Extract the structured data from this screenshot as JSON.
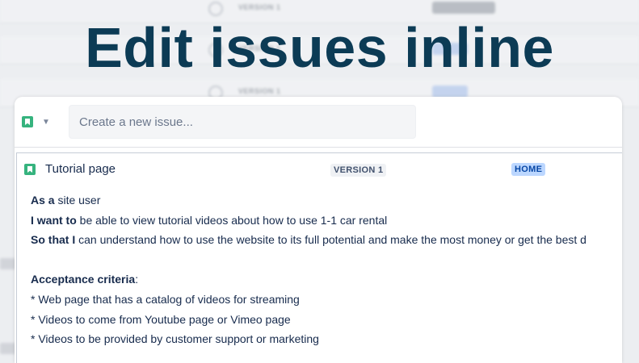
{
  "headline": "Edit issues inline",
  "background_rows": [
    {
      "version": "VERSION 1"
    },
    {
      "version": "VERSION 1"
    },
    {
      "version": "VERSION 1"
    }
  ],
  "create": {
    "placeholder": "Create a new issue...",
    "type_icon": "story-icon",
    "dropdown_icon": "chevron-down-icon"
  },
  "issue": {
    "type_icon": "story-icon",
    "title": "Tutorial page",
    "fix_version": "VERSION 1",
    "epic": "HOME",
    "description": {
      "as_a_label": "As a",
      "as_a_text": " site user",
      "i_want_label": "I want to",
      "i_want_text": " be able to view tutorial videos about how to use 1-1 car rental",
      "so_that_label": "So that I",
      "so_that_text": " can understand how to use the website to its full potential and make the most money or get the best d",
      "criteria_label": "Acceptance criteria",
      "criteria_colon": ":",
      "criteria": [
        "* Web page that has a catalog of videos for streaming",
        "* Videos to come from Youtube page or Vimeo page",
        "* Videos to be provided by customer support or marketing"
      ]
    }
  },
  "colors": {
    "headline": "#0c3b55",
    "story": "#36b37e",
    "epic_bg": "#bcd7ff",
    "epic_text": "#0747a6"
  }
}
